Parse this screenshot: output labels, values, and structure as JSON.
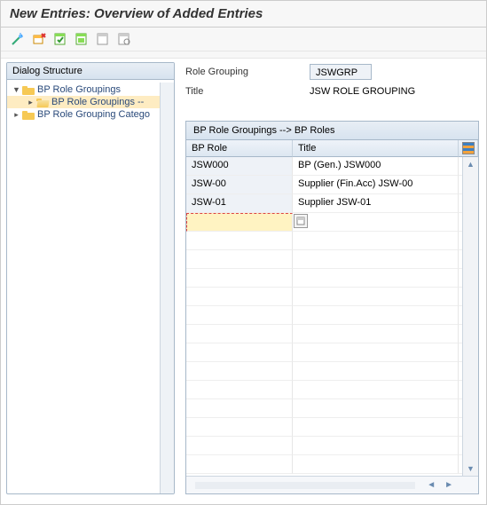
{
  "header": {
    "title": "New Entries: Overview of Added Entries"
  },
  "toolbar": {
    "icons": [
      "tool-wand",
      "tool-delete",
      "tool-select-all",
      "tool-select-block",
      "tool-deselect",
      "tool-print"
    ]
  },
  "tree": {
    "header": "Dialog Structure",
    "nodes": [
      {
        "label": "BP Role Groupings",
        "level": 0,
        "expanded": true,
        "selected": false
      },
      {
        "label": "BP Role Groupings --",
        "level": 1,
        "expanded": false,
        "selected": true
      },
      {
        "label": "BP Role Grouping Catego",
        "level": 0,
        "expanded": false,
        "selected": false
      }
    ]
  },
  "fields": {
    "role_grouping_label": "Role Grouping",
    "role_grouping_value": "JSWGRP",
    "title_label": "Title",
    "title_value": "JSW ROLE GROUPING"
  },
  "grid": {
    "title": "BP Role Groupings --> BP Roles",
    "columns": {
      "role": "BP Role",
      "title": "Title"
    },
    "rows": [
      {
        "role": "JSW000",
        "title": "BP (Gen.) JSW000"
      },
      {
        "role": "JSW-00",
        "title": "Supplier (Fin.Acc) JSW-00"
      },
      {
        "role": "JSW-01",
        "title": "Supplier JSW-01"
      }
    ],
    "empty_rows": 13
  }
}
